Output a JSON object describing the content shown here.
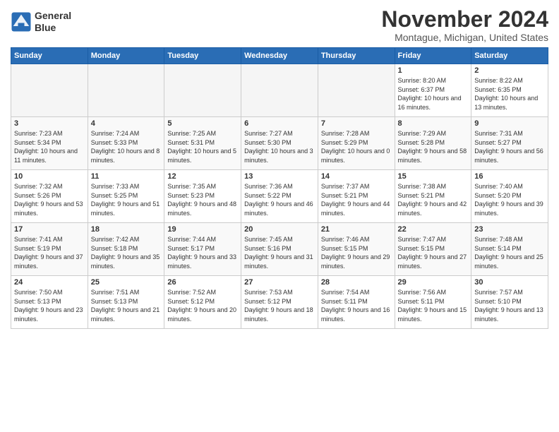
{
  "header": {
    "logo_line1": "General",
    "logo_line2": "Blue",
    "month": "November 2024",
    "location": "Montague, Michigan, United States"
  },
  "weekdays": [
    "Sunday",
    "Monday",
    "Tuesday",
    "Wednesday",
    "Thursday",
    "Friday",
    "Saturday"
  ],
  "weeks": [
    [
      {
        "day": "",
        "info": ""
      },
      {
        "day": "",
        "info": ""
      },
      {
        "day": "",
        "info": ""
      },
      {
        "day": "",
        "info": ""
      },
      {
        "day": "",
        "info": ""
      },
      {
        "day": "1",
        "info": "Sunrise: 8:20 AM\nSunset: 6:37 PM\nDaylight: 10 hours\nand 16 minutes."
      },
      {
        "day": "2",
        "info": "Sunrise: 8:22 AM\nSunset: 6:35 PM\nDaylight: 10 hours\nand 13 minutes."
      }
    ],
    [
      {
        "day": "3",
        "info": "Sunrise: 7:23 AM\nSunset: 5:34 PM\nDaylight: 10 hours\nand 11 minutes."
      },
      {
        "day": "4",
        "info": "Sunrise: 7:24 AM\nSunset: 5:33 PM\nDaylight: 10 hours\nand 8 minutes."
      },
      {
        "day": "5",
        "info": "Sunrise: 7:25 AM\nSunset: 5:31 PM\nDaylight: 10 hours\nand 5 minutes."
      },
      {
        "day": "6",
        "info": "Sunrise: 7:27 AM\nSunset: 5:30 PM\nDaylight: 10 hours\nand 3 minutes."
      },
      {
        "day": "7",
        "info": "Sunrise: 7:28 AM\nSunset: 5:29 PM\nDaylight: 10 hours\nand 0 minutes."
      },
      {
        "day": "8",
        "info": "Sunrise: 7:29 AM\nSunset: 5:28 PM\nDaylight: 9 hours\nand 58 minutes."
      },
      {
        "day": "9",
        "info": "Sunrise: 7:31 AM\nSunset: 5:27 PM\nDaylight: 9 hours\nand 56 minutes."
      }
    ],
    [
      {
        "day": "10",
        "info": "Sunrise: 7:32 AM\nSunset: 5:26 PM\nDaylight: 9 hours\nand 53 minutes."
      },
      {
        "day": "11",
        "info": "Sunrise: 7:33 AM\nSunset: 5:25 PM\nDaylight: 9 hours\nand 51 minutes."
      },
      {
        "day": "12",
        "info": "Sunrise: 7:35 AM\nSunset: 5:23 PM\nDaylight: 9 hours\nand 48 minutes."
      },
      {
        "day": "13",
        "info": "Sunrise: 7:36 AM\nSunset: 5:22 PM\nDaylight: 9 hours\nand 46 minutes."
      },
      {
        "day": "14",
        "info": "Sunrise: 7:37 AM\nSunset: 5:21 PM\nDaylight: 9 hours\nand 44 minutes."
      },
      {
        "day": "15",
        "info": "Sunrise: 7:38 AM\nSunset: 5:21 PM\nDaylight: 9 hours\nand 42 minutes."
      },
      {
        "day": "16",
        "info": "Sunrise: 7:40 AM\nSunset: 5:20 PM\nDaylight: 9 hours\nand 39 minutes."
      }
    ],
    [
      {
        "day": "17",
        "info": "Sunrise: 7:41 AM\nSunset: 5:19 PM\nDaylight: 9 hours\nand 37 minutes."
      },
      {
        "day": "18",
        "info": "Sunrise: 7:42 AM\nSunset: 5:18 PM\nDaylight: 9 hours\nand 35 minutes."
      },
      {
        "day": "19",
        "info": "Sunrise: 7:44 AM\nSunset: 5:17 PM\nDaylight: 9 hours\nand 33 minutes."
      },
      {
        "day": "20",
        "info": "Sunrise: 7:45 AM\nSunset: 5:16 PM\nDaylight: 9 hours\nand 31 minutes."
      },
      {
        "day": "21",
        "info": "Sunrise: 7:46 AM\nSunset: 5:15 PM\nDaylight: 9 hours\nand 29 minutes."
      },
      {
        "day": "22",
        "info": "Sunrise: 7:47 AM\nSunset: 5:15 PM\nDaylight: 9 hours\nand 27 minutes."
      },
      {
        "day": "23",
        "info": "Sunrise: 7:48 AM\nSunset: 5:14 PM\nDaylight: 9 hours\nand 25 minutes."
      }
    ],
    [
      {
        "day": "24",
        "info": "Sunrise: 7:50 AM\nSunset: 5:13 PM\nDaylight: 9 hours\nand 23 minutes."
      },
      {
        "day": "25",
        "info": "Sunrise: 7:51 AM\nSunset: 5:13 PM\nDaylight: 9 hours\nand 21 minutes."
      },
      {
        "day": "26",
        "info": "Sunrise: 7:52 AM\nSunset: 5:12 PM\nDaylight: 9 hours\nand 20 minutes."
      },
      {
        "day": "27",
        "info": "Sunrise: 7:53 AM\nSunset: 5:12 PM\nDaylight: 9 hours\nand 18 minutes."
      },
      {
        "day": "28",
        "info": "Sunrise: 7:54 AM\nSunset: 5:11 PM\nDaylight: 9 hours\nand 16 minutes."
      },
      {
        "day": "29",
        "info": "Sunrise: 7:56 AM\nSunset: 5:11 PM\nDaylight: 9 hours\nand 15 minutes."
      },
      {
        "day": "30",
        "info": "Sunrise: 7:57 AM\nSunset: 5:10 PM\nDaylight: 9 hours\nand 13 minutes."
      }
    ]
  ]
}
